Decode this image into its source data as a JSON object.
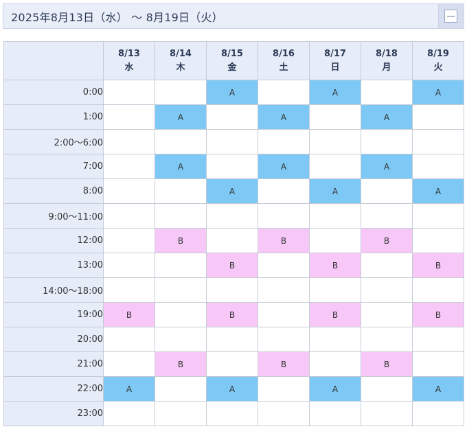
{
  "header": {
    "title": "2025年8月13日（水） 〜 8月19日（火）",
    "collapse_icon": "minus-square-icon"
  },
  "days": [
    {
      "date": "8/13",
      "weekday": "水"
    },
    {
      "date": "8/14",
      "weekday": "木"
    },
    {
      "date": "8/15",
      "weekday": "金"
    },
    {
      "date": "8/16",
      "weekday": "土"
    },
    {
      "date": "8/17",
      "weekday": "日"
    },
    {
      "date": "8/18",
      "weekday": "月"
    },
    {
      "date": "8/19",
      "weekday": "火"
    }
  ],
  "rows": [
    {
      "time": "0:00",
      "cells": [
        "",
        "",
        "A",
        "",
        "A",
        "",
        "A"
      ]
    },
    {
      "time": "1:00",
      "cells": [
        "",
        "A",
        "",
        "A",
        "",
        "A",
        ""
      ]
    },
    {
      "time": "2:00〜6:00",
      "cells": [
        "",
        "",
        "",
        "",
        "",
        "",
        ""
      ]
    },
    {
      "time": "7:00",
      "cells": [
        "",
        "A",
        "",
        "A",
        "",
        "A",
        ""
      ]
    },
    {
      "time": "8:00",
      "cells": [
        "",
        "",
        "A",
        "",
        "A",
        "",
        "A"
      ]
    },
    {
      "time": "9:00〜11:00",
      "cells": [
        "",
        "",
        "",
        "",
        "",
        "",
        ""
      ]
    },
    {
      "time": "12:00",
      "cells": [
        "",
        "B",
        "",
        "B",
        "",
        "B",
        ""
      ]
    },
    {
      "time": "13:00",
      "cells": [
        "",
        "",
        "B",
        "",
        "B",
        "",
        "B"
      ]
    },
    {
      "time": "14:00〜18:00",
      "cells": [
        "",
        "",
        "",
        "",
        "",
        "",
        ""
      ]
    },
    {
      "time": "19:00",
      "cells": [
        "B",
        "",
        "B",
        "",
        "B",
        "",
        "B"
      ]
    },
    {
      "time": "20:00",
      "cells": [
        "",
        "",
        "",
        "",
        "",
        "",
        ""
      ]
    },
    {
      "time": "21:00",
      "cells": [
        "",
        "B",
        "",
        "B",
        "",
        "B",
        ""
      ]
    },
    {
      "time": "22:00",
      "cells": [
        "A",
        "",
        "A",
        "",
        "A",
        "",
        "A"
      ]
    },
    {
      "time": "23:00",
      "cells": [
        "",
        "",
        "",
        "",
        "",
        "",
        ""
      ]
    }
  ],
  "colors": {
    "A": "#7ec8f5",
    "B": "#f7c8f7",
    "header_bg": "#e6ecf8"
  }
}
